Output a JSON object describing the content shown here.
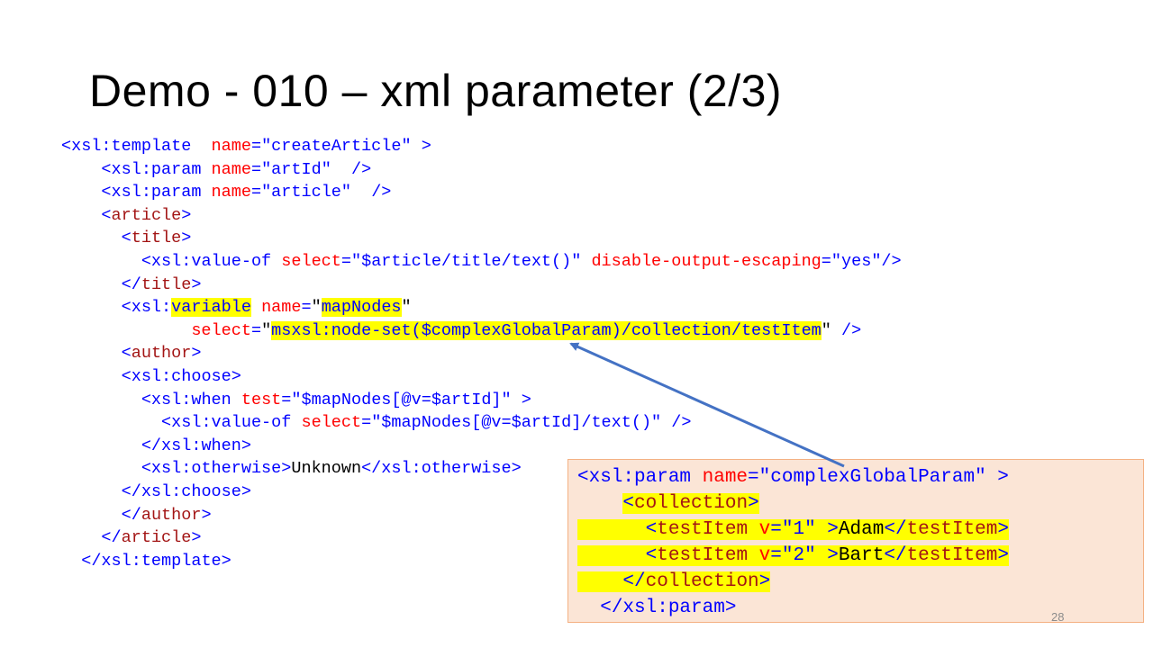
{
  "slide": {
    "title": "Demo - 010 – xml parameter (2/3)",
    "page_number": "28"
  },
  "code": {
    "l1": {
      "open": "<xsl:template  ",
      "attr": "name",
      "eq": "=",
      "val": "\"createArticle\"",
      "close": " >"
    },
    "l2": {
      "indent": "    ",
      "open": "<xsl:param ",
      "attr": "name",
      "eq": "=",
      "val": "\"artId\"",
      "close": "  />"
    },
    "l3": {
      "indent": "    ",
      "open": "<xsl:param ",
      "attr": "name",
      "eq": "=",
      "val": "\"article\"",
      "close": "  />"
    },
    "l4": {
      "indent": "    ",
      "lt": "<",
      "tag": "article",
      "gt": ">"
    },
    "l5": {
      "indent": "      ",
      "lt": "<",
      "tag": "title",
      "gt": ">"
    },
    "l6": {
      "indent": "        ",
      "open": "<xsl:value-of ",
      "attr1": "select",
      "eq1": "=",
      "val1": "\"$article/title/text()\"",
      "attr2": " disable-output-escaping",
      "eq2": "=",
      "val2": "\"yes\"",
      "close": "/>"
    },
    "l7": {
      "indent": "      ",
      "lt": "</",
      "tag": "title",
      "gt": ">"
    },
    "l8": {
      "indent": "      ",
      "open": "<xsl:",
      "kw": "variable",
      "attr": " name",
      "eq": "=",
      "q1": "\"",
      "val": "mapNodes",
      "q2": "\""
    },
    "l9": {
      "indent": "             ",
      "attr": "select",
      "eq": "=",
      "q1": "\"",
      "val": "msxsl:node-set($complexGlobalParam)/collection/testItem",
      "q2": "\"",
      "close": " />"
    },
    "l10": {
      "indent": "      ",
      "lt": "<",
      "tag": "author",
      "gt": ">"
    },
    "l11": {
      "indent": "      ",
      "open": "<xsl:choose>"
    },
    "l12": {
      "indent": "        ",
      "open": "<xsl:when ",
      "attr": "test",
      "eq": "=",
      "val": "\"$mapNodes[@v=$artId]\"",
      "close": " >"
    },
    "l13": {
      "indent": "          ",
      "open": "<xsl:value-of ",
      "attr": "select",
      "eq": "=",
      "val": "\"$mapNodes[@v=$artId]/text()\"",
      "close": " />"
    },
    "l14": {
      "indent": "        ",
      "open": "</xsl:when>"
    },
    "l15": {
      "indent": "        ",
      "open": "<xsl:otherwise>",
      "text": "Unknown",
      "close": "</xsl:otherwise>"
    },
    "l16": {
      "indent": "      ",
      "open": "</xsl:choose>"
    },
    "l17": {
      "indent": "      ",
      "lt": "</",
      "tag": "author",
      "gt": ">"
    },
    "l18": {
      "indent": "    ",
      "lt": "</",
      "tag": "article",
      "gt": ">"
    },
    "l19": {
      "indent": "  ",
      "open": "</xsl:template>"
    }
  },
  "callout": {
    "c1": {
      "open": "<xsl:param ",
      "attr": "name",
      "eq": "=",
      "val": "\"complexGlobalParam\"",
      "close": " >"
    },
    "c2": {
      "indent": "    ",
      "lt": "<",
      "tag": "collection",
      "gt": ">"
    },
    "c3": {
      "indent": "      ",
      "lt": "<",
      "tag": "testItem",
      "sp": " ",
      "attr": "v",
      "eq": "=",
      "val": "\"1\"",
      "gt": " >",
      "text": "Adam",
      "clt": "</",
      "ctag": "testItem",
      "cgt": ">"
    },
    "c4": {
      "indent": "      ",
      "lt": "<",
      "tag": "testItem",
      "sp": " ",
      "attr": "v",
      "eq": "=",
      "val": "\"2\"",
      "gt": " >",
      "text": "Bart",
      "clt": "</",
      "ctag": "testItem",
      "cgt": ">"
    },
    "c5": {
      "indent": "    ",
      "lt": "</",
      "tag": "collection",
      "gt": ">"
    },
    "c6": {
      "indent": "  ",
      "open": "</xsl:param>"
    }
  },
  "colors": {
    "tag": "#0000ff",
    "element": "#a31515",
    "attribute": "#ff0000",
    "highlight": "#ffff00",
    "callout_bg": "#fbe5d6",
    "arrow": "#4472c4"
  }
}
